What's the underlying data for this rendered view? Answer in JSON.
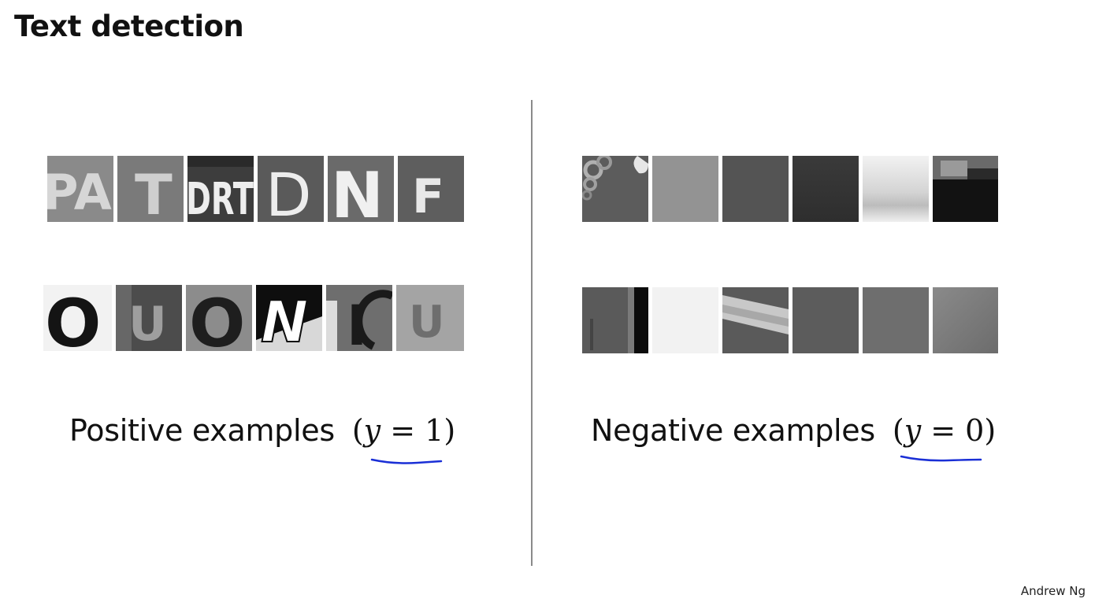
{
  "slide": {
    "title": "Text detection",
    "credit": "Andrew Ng"
  },
  "positive": {
    "label": "Positive examples",
    "math_open": "(",
    "math_var": "y",
    "math_eq": " = ",
    "math_val": "1",
    "math_close": ")",
    "row1_letters": [
      "PA",
      "T",
      "DRT",
      "D",
      "N",
      "F"
    ],
    "row2_letters": [
      "O",
      "U",
      "O",
      "N",
      "I",
      "U"
    ]
  },
  "negative": {
    "label": "Negative examples",
    "math_open": "(",
    "math_var": "y",
    "math_eq": " = ",
    "math_val": "0",
    "math_close": ")"
  },
  "colors": {
    "underline": "#1a2fd6",
    "divider": "#8a8a8a"
  }
}
